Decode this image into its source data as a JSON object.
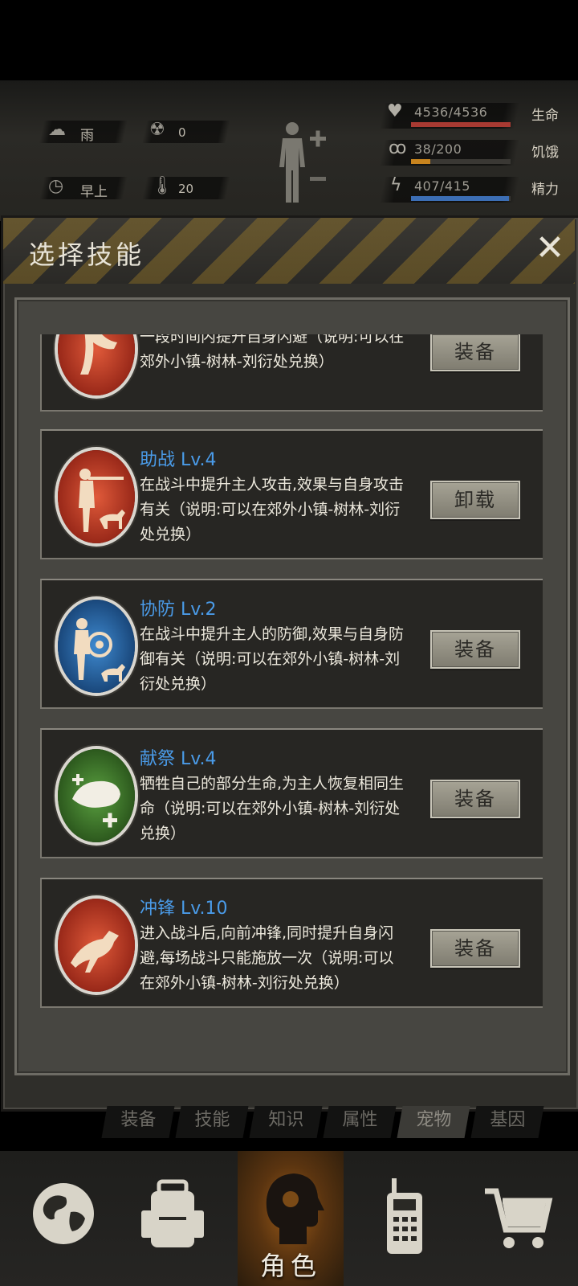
{
  "hud": {
    "weather": {
      "icon": "rain-cloud-icon",
      "value": "雨"
    },
    "radiation": {
      "icon": "radiation-icon",
      "value": "0"
    },
    "time": {
      "icon": "clock-icon",
      "value": "早上"
    },
    "temperature": {
      "icon": "thermometer-icon",
      "value": "20"
    },
    "health": {
      "icon": "heart-icon",
      "value": "4536/4536",
      "label": "生命",
      "fraction": 1.0,
      "color": "#a83a32"
    },
    "hunger": {
      "icon": "stomach-icon",
      "value": "38/200",
      "label": "饥饿",
      "fraction": 0.19,
      "color": "#c8841e"
    },
    "energy": {
      "icon": "energy-icon",
      "value": "407/415",
      "label": "精力",
      "fraction": 0.98,
      "color": "#3c6eb4"
    }
  },
  "modal": {
    "title": "选择技能",
    "close": "✕"
  },
  "skills": [
    {
      "name": "",
      "desc": "一段时间内提升自身闪避（说明:可以在郊外小镇-树林-刘衍处兑换）",
      "button": "装备",
      "icon": "dodge-skill-icon",
      "color": "#b8301c"
    },
    {
      "name": "助战 Lv.4",
      "desc": "在战斗中提升主人攻击,效果与自身攻击有关（说明:可以在郊外小镇-树林-刘衍处兑换）",
      "button": "卸载",
      "icon": "assist-battle-icon",
      "color": "#b8301c"
    },
    {
      "name": "协防 Lv.2",
      "desc": "在战斗中提升主人的防御,效果与自身防御有关（说明:可以在郊外小镇-树林-刘衍处兑换）",
      "button": "装备",
      "icon": "co-defense-icon",
      "color": "#1f5f9c"
    },
    {
      "name": "献祭 Lv.4",
      "desc": "牺牲自己的部分生命,为主人恢复相同生命（说明:可以在郊外小镇-树林-刘衍处兑换）",
      "button": "装备",
      "icon": "sacrifice-icon",
      "color": "#3f7a2a"
    },
    {
      "name": "冲锋 Lv.10",
      "desc": "进入战斗后,向前冲锋,同时提升自身闪避,每场战斗只能施放一次（说明:可以在郊外小镇-树林-刘衍处兑换）",
      "button": "装备",
      "icon": "charge-icon",
      "color": "#b8301c"
    }
  ],
  "subtabs": [
    {
      "label": "装备",
      "active": false
    },
    {
      "label": "技能",
      "active": false
    },
    {
      "label": "知识",
      "active": false
    },
    {
      "label": "属性",
      "active": false
    },
    {
      "label": "宠物",
      "active": true
    },
    {
      "label": "基因",
      "active": false
    }
  ],
  "nav": {
    "world": {
      "icon": "globe-icon"
    },
    "backpack": {
      "icon": "backpack-icon"
    },
    "character": {
      "icon": "head-silhouette-icon",
      "label": "角色"
    },
    "radio": {
      "icon": "walkie-talkie-icon"
    },
    "shop": {
      "icon": "shopping-cart-icon"
    }
  }
}
